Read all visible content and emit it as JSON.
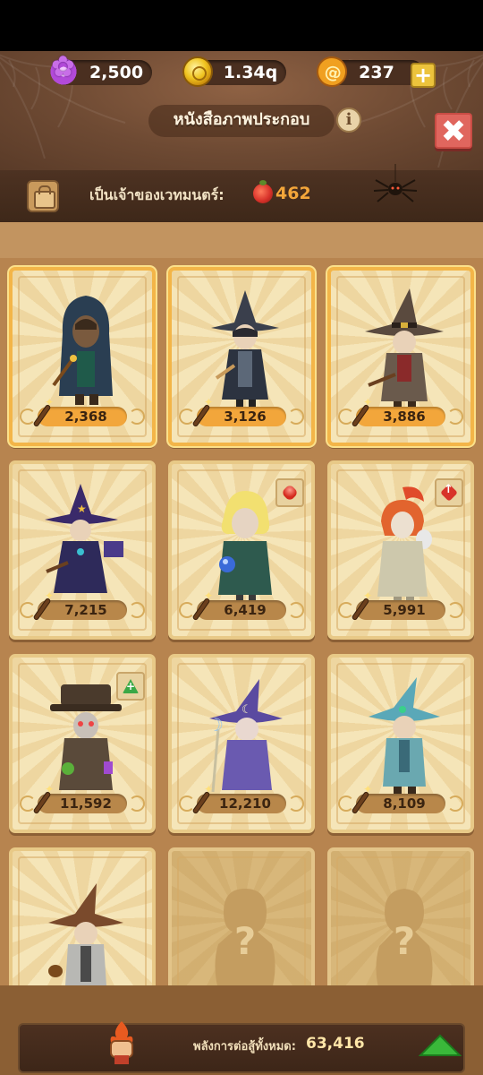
{
  "resources": {
    "gems": "2,500",
    "gold": "1.34q",
    "shards": "237",
    "gem_icon": "purple-flower-gem-icon",
    "gold_icon": "gold-coin-icon",
    "shard_icon": "orange-shard-icon",
    "add_icon": "plus-icon"
  },
  "header": {
    "title": "หนังสือภาพประกอบ",
    "info_label": "i",
    "close_label": "✖"
  },
  "owner": {
    "label": "เป็นเจ้าของเวทมนตร์:",
    "value": "462",
    "icon": "red-berry-icon"
  },
  "cards": [
    {
      "power": "2,368",
      "tier": "gold",
      "character": "hooded-mage",
      "badge": null
    },
    {
      "power": "3,126",
      "tier": "gold",
      "character": "dark-witch-hat-mage",
      "badge": null
    },
    {
      "power": "3,886",
      "tier": "gold",
      "character": "brown-witch-hat-mage",
      "badge": null
    },
    {
      "power": "7,215",
      "tier": "normal",
      "character": "star-hat-mage",
      "badge": null
    },
    {
      "power": "6,419",
      "tier": "normal",
      "character": "blonde-orb-mage",
      "badge": "red-gem"
    },
    {
      "power": "5,991",
      "tier": "normal",
      "character": "phoenix-owl-mage",
      "badge": "red-up"
    },
    {
      "power": "11,592",
      "tier": "normal",
      "character": "plague-doctor-mage",
      "badge": "green-up"
    },
    {
      "power": "12,210",
      "tier": "normal",
      "character": "moon-staff-mage",
      "badge": null
    },
    {
      "power": "8,109",
      "tier": "normal",
      "character": "teal-hat-mage",
      "badge": null
    },
    {
      "power": null,
      "tier": "normal",
      "character": "brown-hat-scholar",
      "badge": null
    },
    {
      "power": null,
      "tier": "locked",
      "character": "unknown",
      "badge": null,
      "locked_label": "?"
    },
    {
      "power": null,
      "tier": "locked",
      "character": "unknown",
      "badge": null,
      "locked_label": "?"
    }
  ],
  "footer": {
    "label": "พลังการต่อสู้ทั้งหมด:",
    "value": "63,416",
    "icon": "flaming-fist-icon",
    "action_icon": "green-up-arrow-icon"
  }
}
